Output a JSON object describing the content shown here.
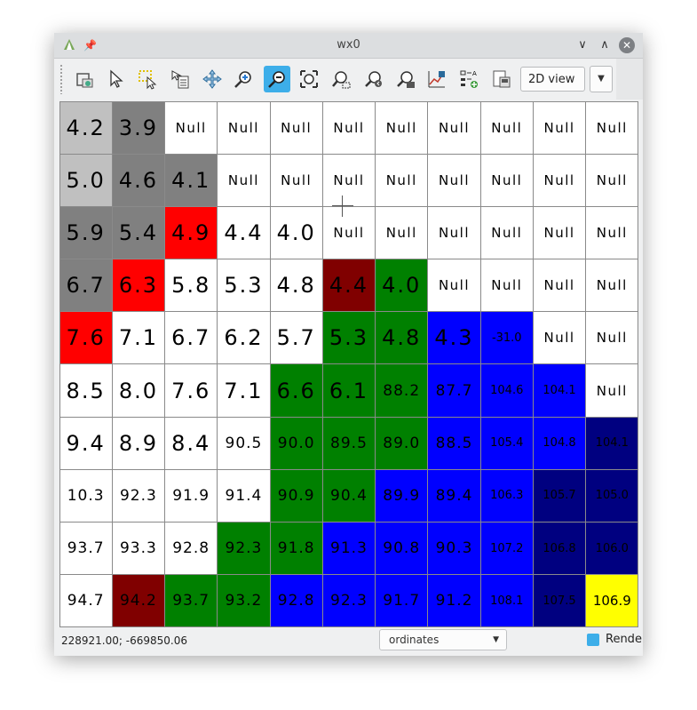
{
  "window": {
    "title": "wx0",
    "min_glyph": "∨",
    "max_glyph": "∧",
    "close_glyph": "✕"
  },
  "toolbar": {
    "tools": [
      {
        "name": "add-layer-icon"
      },
      {
        "name": "pointer-icon"
      },
      {
        "name": "select-icon"
      },
      {
        "name": "query-icon"
      },
      {
        "name": "pan-icon"
      },
      {
        "name": "zoom-in-icon"
      },
      {
        "name": "zoom-out-icon",
        "active": true
      },
      {
        "name": "zoom-extent-icon"
      },
      {
        "name": "zoom-region-icon"
      },
      {
        "name": "zoom-back-icon"
      },
      {
        "name": "zoom-menu-icon"
      },
      {
        "name": "analyze-icon"
      },
      {
        "name": "overlay-icon"
      },
      {
        "name": "save-display-icon"
      }
    ],
    "view_mode": "2D view",
    "view_arrow": "▼"
  },
  "grid": {
    "colors": {
      "white": "#ffffff",
      "gray": "#808080",
      "lightgray": "#c0c0c0",
      "red": "#ff0000",
      "darkred": "#800000",
      "green": "#008000",
      "blue": "#0000ff",
      "navy": "#000080",
      "yellow": "#ffff00"
    },
    "rows": [
      [
        [
          "4.2",
          "lightgray"
        ],
        [
          "3.9",
          "gray"
        ],
        [
          "Null",
          "white"
        ],
        [
          "Null",
          "white"
        ],
        [
          "Null",
          "white"
        ],
        [
          "Null",
          "white"
        ],
        [
          "Null",
          "white"
        ],
        [
          "Null",
          "white"
        ],
        [
          "Null",
          "white"
        ],
        [
          "Null",
          "white"
        ],
        [
          "Null",
          "white"
        ]
      ],
      [
        [
          "5.0",
          "lightgray"
        ],
        [
          "4.6",
          "gray"
        ],
        [
          "4.1",
          "gray"
        ],
        [
          "Null",
          "white"
        ],
        [
          "Null",
          "white"
        ],
        [
          "Null",
          "white"
        ],
        [
          "Null",
          "white"
        ],
        [
          "Null",
          "white"
        ],
        [
          "Null",
          "white"
        ],
        [
          "Null",
          "white"
        ],
        [
          "Null",
          "white"
        ]
      ],
      [
        [
          "5.9",
          "gray"
        ],
        [
          "5.4",
          "gray"
        ],
        [
          "4.9",
          "red"
        ],
        [
          "4.4",
          "white"
        ],
        [
          "4.0",
          "white"
        ],
        [
          "Null",
          "white"
        ],
        [
          "Null",
          "white"
        ],
        [
          "Null",
          "white"
        ],
        [
          "Null",
          "white"
        ],
        [
          "Null",
          "white"
        ],
        [
          "Null",
          "white"
        ]
      ],
      [
        [
          "6.7",
          "gray"
        ],
        [
          "6.3",
          "red"
        ],
        [
          "5.8",
          "white"
        ],
        [
          "5.3",
          "white"
        ],
        [
          "4.8",
          "white"
        ],
        [
          "4.4",
          "darkred"
        ],
        [
          "4.0",
          "green"
        ],
        [
          "Null",
          "white"
        ],
        [
          "Null",
          "white"
        ],
        [
          "Null",
          "white"
        ],
        [
          "Null",
          "white"
        ]
      ],
      [
        [
          "7.6",
          "red"
        ],
        [
          "7.1",
          "white"
        ],
        [
          "6.7",
          "white"
        ],
        [
          "6.2",
          "white"
        ],
        [
          "5.7",
          "white"
        ],
        [
          "5.3",
          "green"
        ],
        [
          "4.8",
          "green"
        ],
        [
          "4.3",
          "blue"
        ],
        [
          "-31.0",
          "blue"
        ],
        [
          "Null",
          "white"
        ],
        [
          "Null",
          "white"
        ]
      ],
      [
        [
          "8.5",
          "white"
        ],
        [
          "8.0",
          "white"
        ],
        [
          "7.6",
          "white"
        ],
        [
          "7.1",
          "white"
        ],
        [
          "6.6",
          "green"
        ],
        [
          "6.1",
          "green"
        ],
        [
          "88.2",
          "green"
        ],
        [
          "87.7",
          "blue"
        ],
        [
          "104.6",
          "blue"
        ],
        [
          "104.1",
          "blue"
        ],
        [
          "Null",
          "white"
        ]
      ],
      [
        [
          "9.4",
          "white"
        ],
        [
          "8.9",
          "white"
        ],
        [
          "8.4",
          "white"
        ],
        [
          "90.5",
          "white"
        ],
        [
          "90.0",
          "green"
        ],
        [
          "89.5",
          "green"
        ],
        [
          "89.0",
          "green"
        ],
        [
          "88.5",
          "blue"
        ],
        [
          "105.4",
          "blue"
        ],
        [
          "104.8",
          "blue"
        ],
        [
          "104.1",
          "navy"
        ]
      ],
      [
        [
          "10.3",
          "white"
        ],
        [
          "92.3",
          "white"
        ],
        [
          "91.9",
          "white"
        ],
        [
          "91.4",
          "white"
        ],
        [
          "90.9",
          "green"
        ],
        [
          "90.4",
          "green"
        ],
        [
          "89.9",
          "blue"
        ],
        [
          "89.4",
          "blue"
        ],
        [
          "106.3",
          "blue"
        ],
        [
          "105.7",
          "navy"
        ],
        [
          "105.0",
          "navy"
        ]
      ],
      [
        [
          "93.7",
          "white"
        ],
        [
          "93.3",
          "white"
        ],
        [
          "92.8",
          "white"
        ],
        [
          "92.3",
          "green"
        ],
        [
          "91.8",
          "green"
        ],
        [
          "91.3",
          "blue"
        ],
        [
          "90.8",
          "blue"
        ],
        [
          "90.3",
          "blue"
        ],
        [
          "107.2",
          "blue"
        ],
        [
          "106.8",
          "navy"
        ],
        [
          "106.0",
          "navy"
        ]
      ],
      [
        [
          "94.7",
          "white"
        ],
        [
          "94.2",
          "darkred"
        ],
        [
          "93.7",
          "green"
        ],
        [
          "93.2",
          "green"
        ],
        [
          "92.8",
          "blue"
        ],
        [
          "92.3",
          "blue"
        ],
        [
          "91.7",
          "blue"
        ],
        [
          "91.2",
          "blue"
        ],
        [
          "108.1",
          "blue"
        ],
        [
          "107.5",
          "navy"
        ],
        [
          "106.9",
          "yellow"
        ]
      ]
    ]
  },
  "statusbar": {
    "coordinates": "228921.00; -669850.06",
    "display_mode": "ordinates",
    "display_arrow": "▼",
    "render_label": "Rende",
    "render_checked": true
  }
}
